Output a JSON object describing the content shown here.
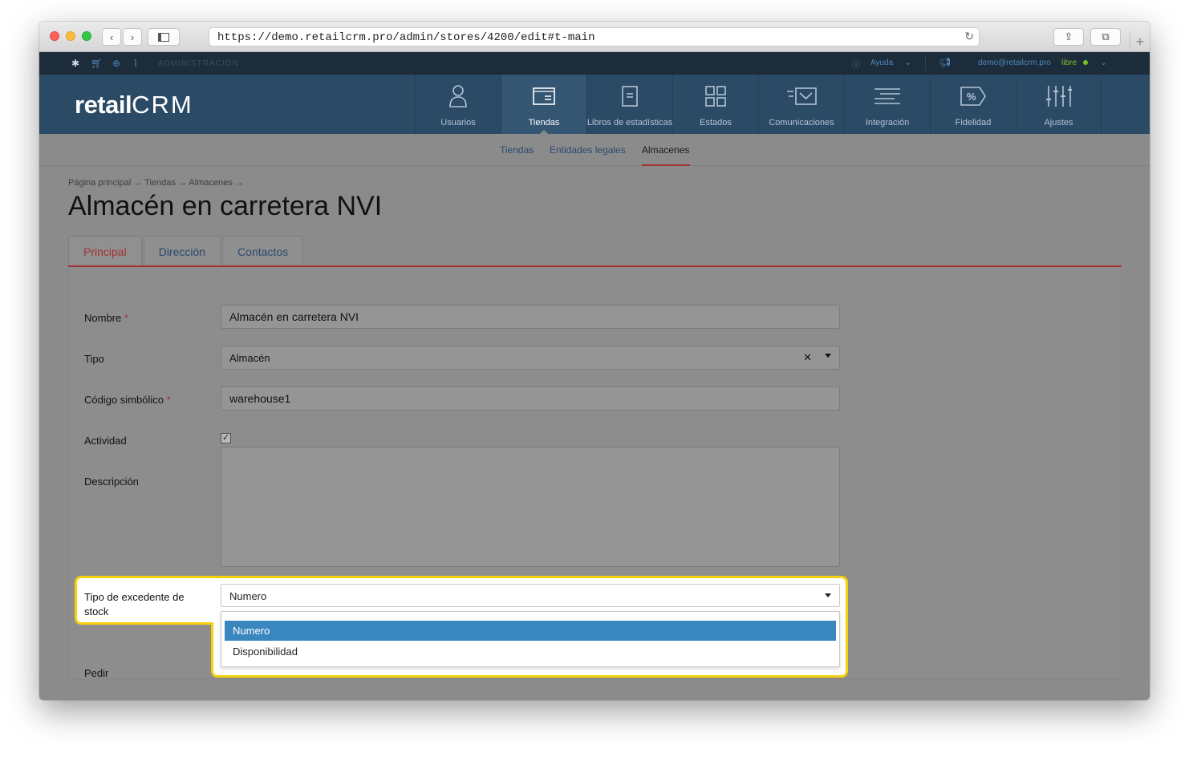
{
  "browser": {
    "url": "https://demo.retailcrm.pro/admin/stores/4200/edit#t-main"
  },
  "admin_bar": {
    "section_label": "ADMINISTRACIÓN",
    "help_label": "Ayuda",
    "user_email": "demo@retailcrm.pro",
    "plan_label": "libre"
  },
  "logo": {
    "text_retail": "retail",
    "text_crm": "CRM"
  },
  "nav": {
    "items": [
      {
        "label": "Usuarios",
        "icon": "user-icon"
      },
      {
        "label": "Tiendas",
        "icon": "store-icon"
      },
      {
        "label": "Libros de estadísticas",
        "icon": "book-icon"
      },
      {
        "label": "Estados",
        "icon": "grid-icon"
      },
      {
        "label": "Comunicaciones",
        "icon": "message-icon"
      },
      {
        "label": "Integración",
        "icon": "lines-icon"
      },
      {
        "label": "Fidelidad",
        "icon": "percent-icon"
      },
      {
        "label": "Ajustes",
        "icon": "sliders-icon"
      }
    ],
    "active": "Tiendas"
  },
  "subnav": {
    "items": [
      "Tiendas",
      "Entidades legales",
      "Almacenes"
    ],
    "active": "Almacenes"
  },
  "breadcrumb": "Página principal → Tiendas → Almacenes →",
  "page_title": "Almacén en carretera NVI",
  "tabs": [
    "Principal",
    "Dirección",
    "Contactos"
  ],
  "active_tab": "Principal",
  "form": {
    "name_label": "Nombre",
    "name_value": "Almacén en carretera NVI",
    "type_label": "Tipo",
    "type_value": "Almacén",
    "code_label": "Código simbólico",
    "code_value": "warehouse1",
    "activity_label": "Actividad",
    "activity_checked": true,
    "description_label": "Descripción",
    "description_value": "",
    "stock_label": "Tipo de excedente de stock",
    "stock_value": "Numero",
    "stock_options": [
      "Numero",
      "Disponibilidad"
    ],
    "order_label": "Pedir"
  },
  "colors": {
    "nav_bg": "#2b4a66",
    "admin_bg": "#1d2c3b",
    "accent_red": "#a33232",
    "highlight": "#f5d10a",
    "selected_option": "#3a86bf"
  }
}
